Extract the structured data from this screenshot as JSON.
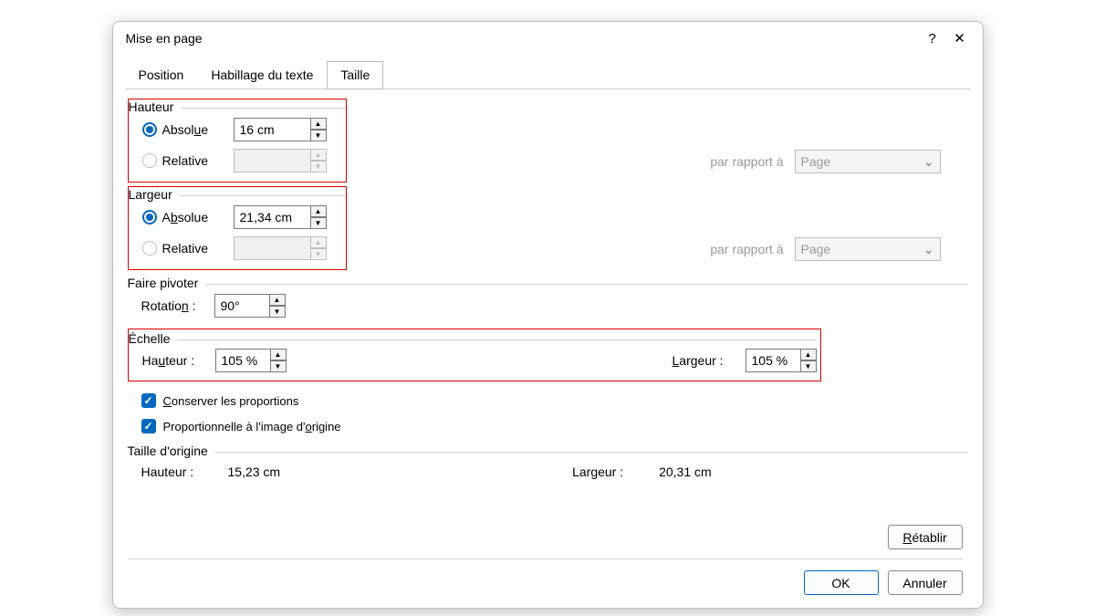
{
  "titlebar": {
    "title": "Mise en page",
    "help": "?",
    "close": "✕"
  },
  "tabs": {
    "position": "Position",
    "wrap": "Habillage du texte",
    "size": "Taille"
  },
  "height": {
    "legend": "Hauteur",
    "abs_label": "Absolue",
    "abs_value": "16 cm",
    "rel_label": "Relative",
    "rel_value": "",
    "rel_ref_label": "par rapport à",
    "rel_ref_value": "Page"
  },
  "width": {
    "legend": "Largeur",
    "abs_label": "Absolue",
    "abs_value": "21,34 cm",
    "rel_label": "Relative",
    "rel_value": "",
    "rel_ref_label": "par rapport à",
    "rel_ref_value": "Page"
  },
  "rotate": {
    "legend": "Faire pivoter",
    "label": "Rotation :",
    "value": "90°"
  },
  "scale": {
    "legend": "Échelle",
    "h_label": "Hauteur :",
    "h_value": "105 %",
    "w_label": "Largeur :",
    "w_value": "105 %",
    "keep_ratio": "Conserver les proportions",
    "relative_original": "Proportionnelle à l'image d'origine"
  },
  "original": {
    "legend": "Taille d'origine",
    "h_label": "Hauteur :",
    "h_value": "15,23 cm",
    "w_label": "Largeur :",
    "w_value": "20,31 cm"
  },
  "buttons": {
    "reset": "Rétablir",
    "ok": "OK",
    "cancel": "Annuler"
  }
}
